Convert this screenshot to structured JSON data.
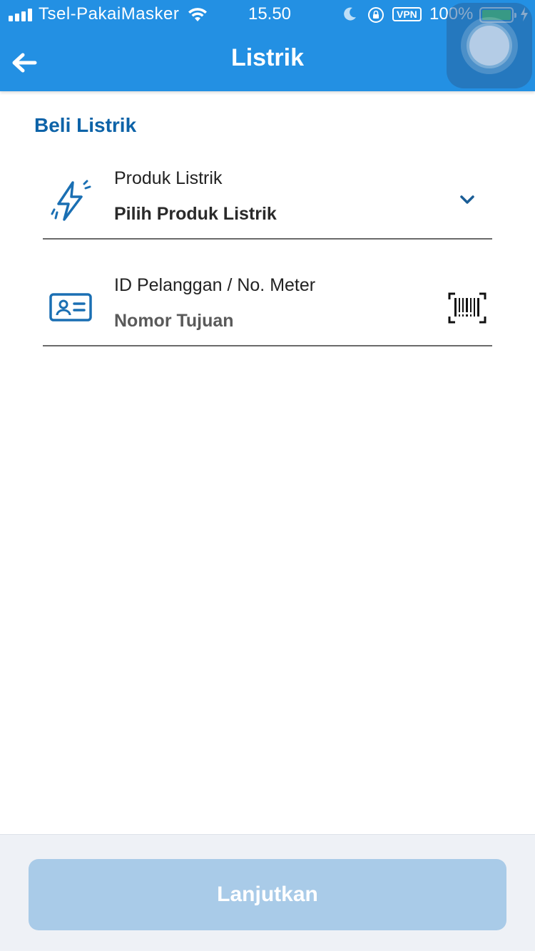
{
  "status_bar": {
    "carrier": "Tsel-PakaiMasker",
    "time": "15.50",
    "vpn": "VPN",
    "battery_percent": "100%",
    "battery_level": 1.0
  },
  "header": {
    "title": "Listrik",
    "background_color": "#2390e3"
  },
  "main": {
    "section_title": "Beli Listrik",
    "product_field": {
      "label": "Produk Listrik",
      "placeholder": "Pilih Produk Listrik",
      "icon": "lightning-icon",
      "trailing_icon": "chevron-down-icon"
    },
    "customer_field": {
      "label": "ID Pelanggan / No. Meter",
      "placeholder": "Nomor Tujuan",
      "icon": "id-card-icon",
      "trailing_icon": "barcode-scan-icon"
    }
  },
  "footer": {
    "continue_label": "Lanjutkan",
    "continue_enabled": false
  }
}
